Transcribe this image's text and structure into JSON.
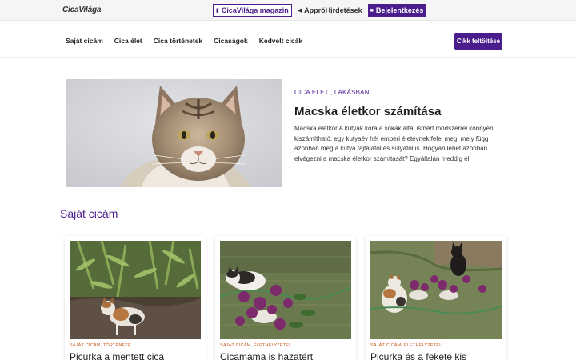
{
  "header": {
    "logo": "CicaVilága",
    "top_links": [
      {
        "label": "CicaVilága magazin",
        "icon": "book-icon"
      },
      {
        "label": "AppróHirdetések",
        "icon": "megaphone-icon"
      },
      {
        "label": "Bejelentkezés",
        "icon": "lock-icon"
      }
    ]
  },
  "nav": {
    "items": [
      "Saját cicám",
      "Cica élet",
      "Cica történetek",
      "Cicaságok",
      "Kedvelt cicák"
    ],
    "cta": "Cikk feltöltése"
  },
  "featured": {
    "category": "CICA ÉLET , LAKÁSBAN",
    "title": "Macska életkor számítása",
    "excerpt": "Macska életkor A kutyák kora a sokak által ismert módszerrel könnyen kiszámítható: egy kutyaév hét emberi életévnek felel meg, mely függ azonban még a kutya fajtájától és súlyától is. Hogyan lehet azonban elvégezni a macska életkor számítását? Egyáltalán meddig él"
  },
  "section": {
    "title": "Saját cicám",
    "cards": [
      {
        "category": "SAJÁT CICÁM, TÖRTÉNETE",
        "title": "Picurka a mentett cica"
      },
      {
        "category": "SAJÁT CICÁM, ÉLETHELYZETEI",
        "title": "Cicamama is hazatért"
      },
      {
        "category": "SAJÁT CICÁM, ÉLETHELYZETEI",
        "title": "Picurka és a fekete kis"
      }
    ]
  },
  "colors": {
    "accent": "#4b1c8c",
    "category": "#c8561a"
  }
}
